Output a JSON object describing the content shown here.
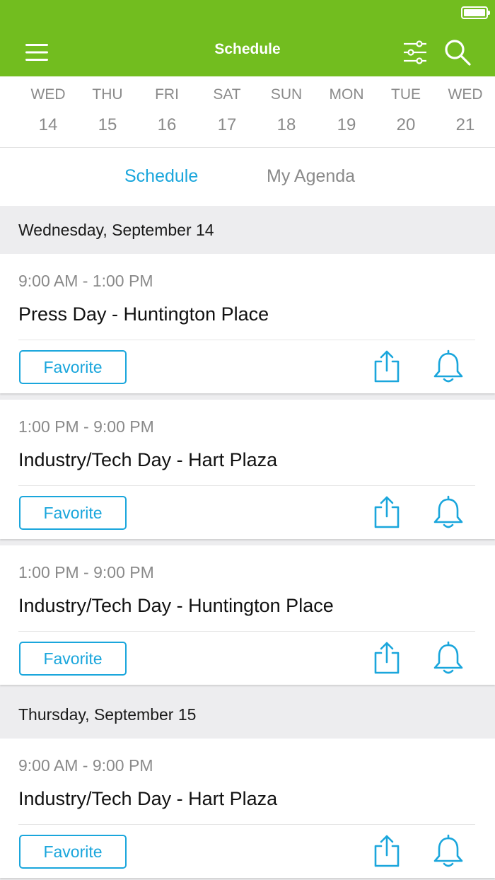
{
  "navbar": {
    "title": "Schedule"
  },
  "dates": [
    {
      "dow": "WED",
      "num": "14"
    },
    {
      "dow": "THU",
      "num": "15"
    },
    {
      "dow": "FRI",
      "num": "16"
    },
    {
      "dow": "SAT",
      "num": "17"
    },
    {
      "dow": "SUN",
      "num": "18"
    },
    {
      "dow": "MON",
      "num": "19"
    },
    {
      "dow": "TUE",
      "num": "20"
    },
    {
      "dow": "WED",
      "num": "21"
    }
  ],
  "tabs": {
    "schedule": "Schedule",
    "agenda": "My Agenda"
  },
  "sections": [
    {
      "label": "Wednesday, September 14"
    },
    {
      "label": "Thursday, September 15"
    }
  ],
  "events": [
    {
      "time": "9:00 AM - 1:00 PM",
      "title": "Press Day - Huntington Place",
      "favorite": "Favorite"
    },
    {
      "time": "1:00 PM - 9:00 PM",
      "title": "Industry/Tech Day - Hart Plaza",
      "favorite": "Favorite"
    },
    {
      "time": "1:00 PM - 9:00 PM",
      "title": "Industry/Tech Day - Huntington Place",
      "favorite": "Favorite"
    },
    {
      "time": "9:00 AM - 9:00 PM",
      "title": "Industry/Tech Day - Hart Plaza",
      "favorite": "Favorite"
    }
  ],
  "colors": {
    "brand": "#72bd1f",
    "accent": "#1aa6dc",
    "muted": "#8a8a8a"
  },
  "icons": {
    "menu": "menu-icon",
    "filter": "filter-icon",
    "search": "search-icon",
    "share": "share-icon",
    "bell": "bell-icon",
    "battery": "battery-icon"
  }
}
